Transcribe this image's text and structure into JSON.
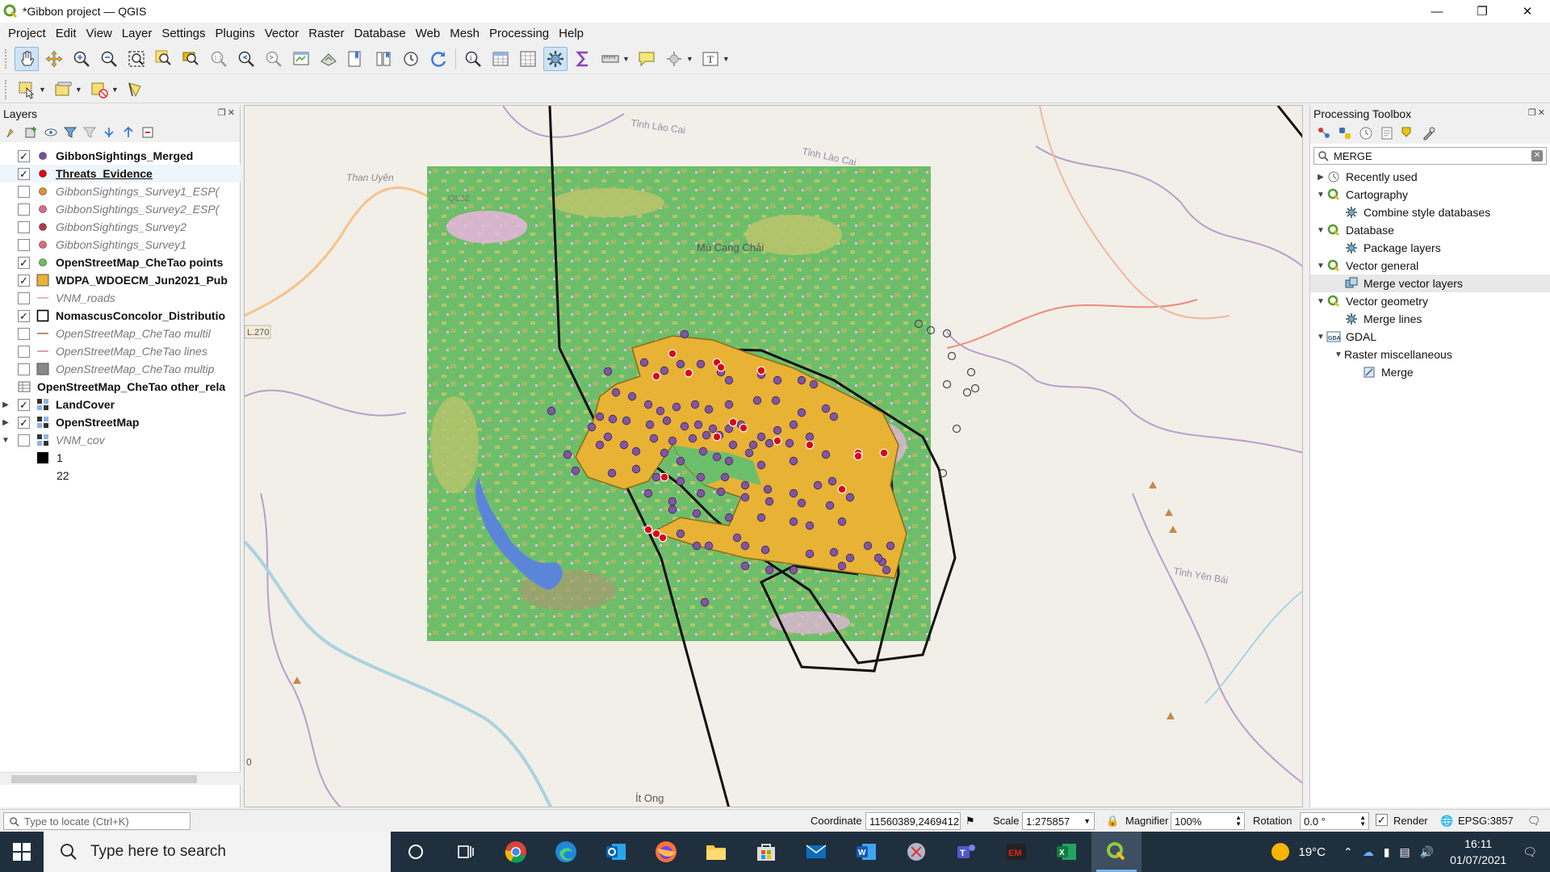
{
  "window": {
    "title": "*Gibbon project — QGIS",
    "controls": [
      "minimize-icon",
      "restore-icon",
      "close-icon"
    ]
  },
  "menu": [
    "Project",
    "Edit",
    "View",
    "Layer",
    "Settings",
    "Plugins",
    "Vector",
    "Raster",
    "Database",
    "Web",
    "Mesh",
    "Processing",
    "Help"
  ],
  "layers_panel": {
    "title": "Layers",
    "layers": [
      {
        "name": "GibbonSightings_Merged",
        "checked": true,
        "style": "bold",
        "symbol": "point",
        "color": "#7b4fa0",
        "expand": ""
      },
      {
        "name": "Threats_Evidence",
        "checked": true,
        "style": "ul",
        "symbol": "point",
        "color": "#e0001a",
        "expand": ""
      },
      {
        "name": "GibbonSightings_Survey1_ESP(",
        "checked": false,
        "style": "italic",
        "symbol": "point",
        "color": "#e8902a",
        "expand": ""
      },
      {
        "name": "GibbonSightings_Survey2_ESP(",
        "checked": false,
        "style": "italic",
        "symbol": "point",
        "color": "#e06a85",
        "expand": ""
      },
      {
        "name": "GibbonSightings_Survey2",
        "checked": false,
        "style": "italic",
        "symbol": "point",
        "color": "#b23a48",
        "expand": ""
      },
      {
        "name": "GibbonSightings_Survey1",
        "checked": false,
        "style": "italic",
        "symbol": "point",
        "color": "#e46a7a",
        "expand": ""
      },
      {
        "name": "OpenStreetMap_CheTao points",
        "checked": true,
        "style": "bold",
        "symbol": "point",
        "color": "#6cbf58",
        "expand": ""
      },
      {
        "name": "WDPA_WDOECM_Jun2021_Pub",
        "checked": true,
        "style": "bold",
        "symbol": "fill",
        "color": "#e8b235",
        "expand": ""
      },
      {
        "name": "VNM_roads",
        "checked": false,
        "style": "italic",
        "symbol": "line",
        "color": "#e8a0b0",
        "expand": ""
      },
      {
        "name": "NomascusConcolor_Distributio",
        "checked": true,
        "style": "bold",
        "symbol": "outline",
        "color": "#000000",
        "expand": ""
      },
      {
        "name": "OpenStreetMap_CheTao multil",
        "checked": false,
        "style": "italic",
        "symbol": "line",
        "color": "#b07050",
        "expand": ""
      },
      {
        "name": "OpenStreetMap_CheTao lines",
        "checked": false,
        "style": "italic",
        "symbol": "line",
        "color": "#d48a9a",
        "expand": ""
      },
      {
        "name": "OpenStreetMap_CheTao multip",
        "checked": false,
        "style": "italic",
        "symbol": "fill",
        "color": "#888888",
        "expand": ""
      },
      {
        "name": "OpenStreetMap_CheTao other_rela",
        "checked": null,
        "style": "bold",
        "symbol": "table",
        "color": "#666666",
        "expand": ""
      },
      {
        "name": "LandCover",
        "checked": true,
        "style": "bold",
        "symbol": "raster",
        "color": "#333333",
        "expand": "▶"
      },
      {
        "name": "OpenStreetMap",
        "checked": true,
        "style": "bold",
        "symbol": "raster",
        "color": "#333333",
        "expand": "▶"
      },
      {
        "name": "VNM_cov",
        "checked": false,
        "style": "italic",
        "symbol": "raster",
        "color": "#333333",
        "expand": "▼"
      }
    ],
    "legend": [
      {
        "label": "1",
        "color": "#000000"
      },
      {
        "label": "22",
        "color": ""
      }
    ]
  },
  "map": {
    "place_labels": [
      "Tỉnh Lào Cai",
      "Tỉnh Lào Cai",
      "Than Uyên",
      "QL32",
      "Mù Cang Chải",
      "Tỉnh Yên Bái",
      "Ít Ong",
      "L.270",
      "0"
    ],
    "colors": {
      "background": "#f2efe9",
      "landcover_forest": "#6cbf6a",
      "landcover_crop": "#b8c46c",
      "landcover_urban": "#f0b5e6",
      "protected_area": "#e8b235",
      "sighting": "#8255a3",
      "threat": "#e0001a",
      "water": "#5b85d8"
    }
  },
  "toolbox": {
    "title": "Processing Toolbox",
    "search": "MERGE",
    "items": [
      {
        "label": "Recently used",
        "indent": 0,
        "expand": "▶",
        "icon": "clock-icon"
      },
      {
        "label": "Cartography",
        "indent": 0,
        "expand": "▼",
        "icon": "qgis-icon"
      },
      {
        "label": "Combine style databases",
        "indent": 1,
        "expand": "",
        "icon": "gear-icon"
      },
      {
        "label": "Database",
        "indent": 0,
        "expand": "▼",
        "icon": "qgis-icon"
      },
      {
        "label": "Package layers",
        "indent": 1,
        "expand": "",
        "icon": "gear-icon"
      },
      {
        "label": "Vector general",
        "indent": 0,
        "expand": "▼",
        "icon": "qgis-icon"
      },
      {
        "label": "Merge vector layers",
        "indent": 1,
        "expand": "",
        "icon": "merge-layers-icon",
        "highlight": true
      },
      {
        "label": "Vector geometry",
        "indent": 0,
        "expand": "▼",
        "icon": "qgis-icon"
      },
      {
        "label": "Merge lines",
        "indent": 1,
        "expand": "",
        "icon": "gear-icon"
      },
      {
        "label": "GDAL",
        "indent": 0,
        "expand": "▼",
        "icon": "gdal-icon"
      },
      {
        "label": "Raster miscellaneous",
        "indent": 1,
        "expand": "▼",
        "icon": ""
      },
      {
        "label": "Merge",
        "indent": 2,
        "expand": "",
        "icon": "gdal-tool-icon"
      }
    ]
  },
  "status": {
    "locator_placeholder": "Type to locate (Ctrl+K)",
    "coordinate_label": "Coordinate",
    "coordinate": "11560389,2469412",
    "scale_label": "Scale",
    "scale": "1:275857",
    "magnifier_label": "Magnifier",
    "magnifier": "100%",
    "rotation_label": "Rotation",
    "rotation": "0.0 °",
    "render_label": "Render",
    "render_checked": true,
    "crs": "EPSG:3857"
  },
  "taskbar": {
    "search_placeholder": "Type here to search",
    "weather": "19°C",
    "time": "16:11",
    "date": "01/07/2021"
  }
}
